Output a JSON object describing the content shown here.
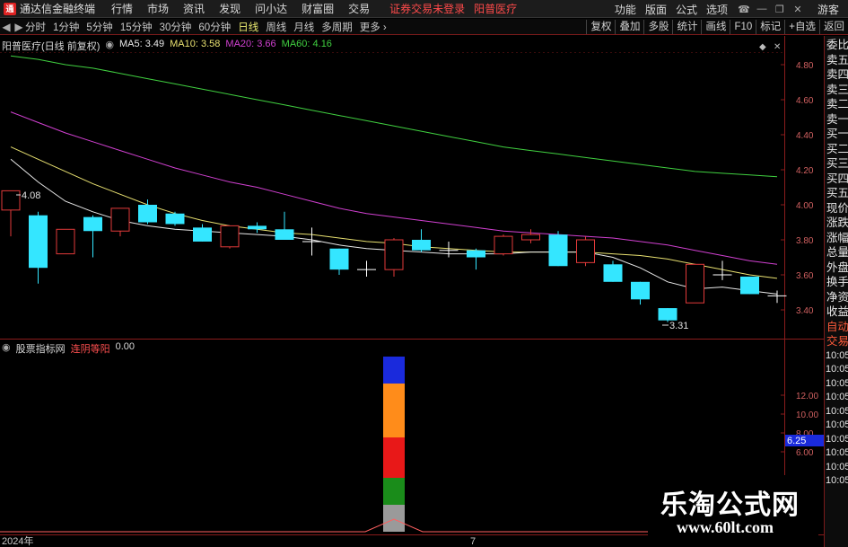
{
  "app": {
    "title": "通达信金融终端",
    "logo_text": "通",
    "menu": [
      "行情",
      "市场",
      "资讯",
      "发现",
      "问小达",
      "财富圈",
      "交易"
    ],
    "login_status": "证券交易未登录",
    "stock_name": "阳普医疗",
    "right_menu": [
      "功能",
      "版面",
      "公式",
      "选项"
    ],
    "guest_label": "游客"
  },
  "tabs": {
    "periods": [
      "分时",
      "1分钟",
      "5分钟",
      "15分钟",
      "30分钟",
      "60分钟",
      "日线",
      "周线",
      "月线",
      "多周期",
      "更多"
    ],
    "active": "日线",
    "tools": [
      "复权",
      "叠加",
      "多股",
      "统计",
      "画线",
      "F10",
      "标记",
      "+自选",
      "返回"
    ]
  },
  "info": {
    "title": "阳普医疗(日线 前复权)",
    "ma5": "MA5: 3.49",
    "ma10": "MA10: 3.58",
    "ma20": "MA20: 3.66",
    "ma60": "MA60: 4.16",
    "high_label": "4.08",
    "low_label": "3.31"
  },
  "indicator": {
    "name": "股票指标网",
    "formula": "连阴等阳",
    "value": "0.00",
    "current_value": "6.25"
  },
  "axis": {
    "price_ticks": [
      "4.80",
      "4.60",
      "4.40",
      "4.20",
      "4.00",
      "3.80",
      "3.60",
      "3.40"
    ],
    "ind_ticks": [
      "12.00",
      "10.00",
      "8.00",
      "6.00"
    ],
    "date_labels": [
      "2024年",
      "7"
    ]
  },
  "side_panel": {
    "items": [
      "委比",
      "卖五",
      "卖四",
      "卖三",
      "卖二",
      "卖一",
      "买一",
      "买二",
      "买三",
      "买四",
      "买五",
      "现价",
      "涨跌",
      "涨幅",
      "总量",
      "外盘",
      "换手",
      "净资",
      "收益"
    ],
    "trade_labels": [
      "自动",
      "交易"
    ],
    "times": [
      "10:05",
      "10:05",
      "10:05",
      "10:05",
      "10:05",
      "10:05",
      "10:05",
      "10:05",
      "10:05",
      "10:05"
    ]
  },
  "colors": {
    "up": "#e23a3a",
    "down": "#34e6ff",
    "flat": "#ffffff",
    "ma5": "#e8e8e8",
    "ma10": "#e8e070",
    "ma20": "#d040d0",
    "ma60": "#40d040",
    "ind_bar": [
      "#9a9a9a",
      "#1a8c1a",
      "#e81818",
      "#ff8c1a",
      "#1a2adc"
    ]
  },
  "chart_data": {
    "type": "candlestick",
    "ylim": [
      3.27,
      4.88
    ],
    "candles": [
      {
        "o": 3.97,
        "h": 4.08,
        "l": 3.82,
        "c": 4.08
      },
      {
        "o": 3.94,
        "h": 3.96,
        "l": 3.55,
        "c": 3.64
      },
      {
        "o": 3.72,
        "h": 3.86,
        "l": 3.72,
        "c": 3.86
      },
      {
        "o": 3.93,
        "h": 3.94,
        "l": 3.7,
        "c": 3.85
      },
      {
        "o": 3.85,
        "h": 3.98,
        "l": 3.82,
        "c": 3.98
      },
      {
        "o": 4.0,
        "h": 4.03,
        "l": 3.89,
        "c": 3.9
      },
      {
        "o": 3.95,
        "h": 3.96,
        "l": 3.88,
        "c": 3.89
      },
      {
        "o": 3.87,
        "h": 3.89,
        "l": 3.79,
        "c": 3.79
      },
      {
        "o": 3.76,
        "h": 3.88,
        "l": 3.75,
        "c": 3.88
      },
      {
        "o": 3.88,
        "h": 3.9,
        "l": 3.84,
        "c": 3.86
      },
      {
        "o": 3.86,
        "h": 3.96,
        "l": 3.8,
        "c": 3.8
      },
      {
        "o": 3.79,
        "h": 3.87,
        "l": 3.71,
        "c": 3.78
      },
      {
        "o": 3.75,
        "h": 3.75,
        "l": 3.6,
        "c": 3.63
      },
      {
        "o": 3.63,
        "h": 3.68,
        "l": 3.59,
        "c": 3.63
      },
      {
        "o": 3.63,
        "h": 3.81,
        "l": 3.59,
        "c": 3.8
      },
      {
        "o": 3.8,
        "h": 3.86,
        "l": 3.73,
        "c": 3.74
      },
      {
        "o": 3.74,
        "h": 3.79,
        "l": 3.7,
        "c": 3.74
      },
      {
        "o": 3.74,
        "h": 3.75,
        "l": 3.63,
        "c": 3.7
      },
      {
        "o": 3.72,
        "h": 3.83,
        "l": 3.71,
        "c": 3.82
      },
      {
        "o": 3.8,
        "h": 3.86,
        "l": 3.78,
        "c": 3.83
      },
      {
        "o": 3.83,
        "h": 3.85,
        "l": 3.65,
        "c": 3.65
      },
      {
        "o": 3.67,
        "h": 3.82,
        "l": 3.65,
        "c": 3.8
      },
      {
        "o": 3.66,
        "h": 3.68,
        "l": 3.56,
        "c": 3.56
      },
      {
        "o": 3.56,
        "h": 3.56,
        "l": 3.43,
        "c": 3.46
      },
      {
        "o": 3.41,
        "h": 3.41,
        "l": 3.33,
        "c": 3.34
      },
      {
        "o": 3.44,
        "h": 3.66,
        "l": 3.44,
        "c": 3.66
      },
      {
        "o": 3.6,
        "h": 3.68,
        "l": 3.57,
        "c": 3.6
      },
      {
        "o": 3.59,
        "h": 3.59,
        "l": 3.49,
        "c": 3.49
      },
      {
        "o": 3.48,
        "h": 3.51,
        "l": 3.44,
        "c": 3.48
      }
    ],
    "ma5": [
      4.26,
      4.13,
      4.02,
      3.96,
      3.91,
      3.88,
      3.86,
      3.85,
      3.84,
      3.83,
      3.82,
      3.8,
      3.77,
      3.75,
      3.74,
      3.73,
      3.72,
      3.72,
      3.72,
      3.73,
      3.73,
      3.73,
      3.7,
      3.64,
      3.56,
      3.52,
      3.53,
      3.51,
      3.49
    ],
    "ma10": [
      4.33,
      4.26,
      4.19,
      4.12,
      4.06,
      4.0,
      3.95,
      3.91,
      3.88,
      3.86,
      3.84,
      3.83,
      3.81,
      3.79,
      3.78,
      3.76,
      3.75,
      3.74,
      3.73,
      3.73,
      3.73,
      3.73,
      3.72,
      3.71,
      3.69,
      3.66,
      3.63,
      3.6,
      3.58
    ],
    "ma20": [
      4.53,
      4.47,
      4.41,
      4.36,
      4.31,
      4.26,
      4.21,
      4.17,
      4.13,
      4.1,
      4.06,
      4.02,
      3.98,
      3.95,
      3.93,
      3.91,
      3.89,
      3.87,
      3.85,
      3.84,
      3.83,
      3.82,
      3.81,
      3.79,
      3.77,
      3.74,
      3.71,
      3.68,
      3.66
    ],
    "ma60": [
      4.85,
      4.83,
      4.8,
      4.78,
      4.75,
      4.72,
      4.69,
      4.66,
      4.63,
      4.6,
      4.57,
      4.54,
      4.51,
      4.48,
      4.45,
      4.42,
      4.39,
      4.36,
      4.33,
      4.31,
      4.29,
      4.27,
      4.25,
      4.23,
      4.21,
      4.19,
      4.18,
      4.17,
      4.16
    ],
    "indicator_bar": {
      "index": 14,
      "segments": [
        2,
        2,
        3,
        4,
        2
      ]
    },
    "indicator_ylim": [
      0,
      13.5
    ]
  },
  "watermark": {
    "main": "乐淘公式网",
    "url": "www.60lt.com"
  }
}
